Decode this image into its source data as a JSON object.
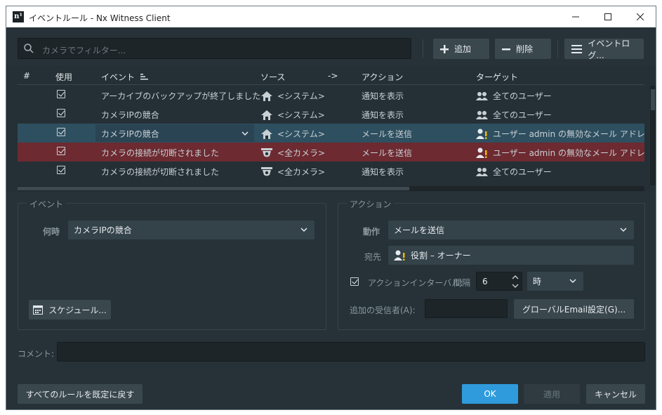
{
  "window": {
    "app_icon": "n¹",
    "title": "イベントルール - Nx Witness Client"
  },
  "toolbar": {
    "search_placeholder": "カメラでフィルター...",
    "add_label": "追加",
    "delete_label": "削除",
    "eventlog_label": "イベントログ..."
  },
  "table": {
    "headers": {
      "num": "#",
      "enabled": "使用",
      "event": "イベント",
      "source": "ソース",
      "arrow": "->",
      "action": "アクション",
      "target": "ターゲット"
    },
    "rows": [
      {
        "event": "アーカイブのバックアップが終了しました",
        "source": "<システム>",
        "source_icon": "home-icon",
        "action": "通知を表示",
        "target": "全てのユーザー",
        "target_icon": "users-icon",
        "state": "normal"
      },
      {
        "event": "カメラIPの競合",
        "source": "<システム>",
        "source_icon": "home-icon",
        "action": "通知を表示",
        "target": "全てのユーザー",
        "target_icon": "users-icon",
        "state": "normal"
      },
      {
        "event": "カメラIPの競合",
        "source": "<システム>",
        "source_icon": "home-icon",
        "action": "メールを送信",
        "target": "ユーザー admin の無効なメール アドレス",
        "target_icon": "user-warning-icon",
        "state": "selected"
      },
      {
        "event": "カメラの接続が切断されました",
        "source": "<全カメラ>",
        "source_icon": "camera-icon",
        "action": "メールを送信",
        "target": "ユーザー admin の無効なメール アドレス",
        "target_icon": "user-warning-icon",
        "state": "error"
      },
      {
        "event": "カメラの接続が切断されました",
        "source": "<全カメラ>",
        "source_icon": "camera-icon",
        "action": "通知を表示",
        "target": "全てのユーザー",
        "target_icon": "users-icon",
        "state": "normal"
      }
    ]
  },
  "event_panel": {
    "title": "イベント",
    "when_label": "何時",
    "when_value": "カメラIPの競合",
    "schedule_label": "スケジュール..."
  },
  "action_panel": {
    "title": "アクション",
    "action_label": "動作",
    "action_value": "メールを送信",
    "to_label": "宛先",
    "to_value": "役割 – オーナー",
    "interval_label": "アクションインターバル:",
    "interval_sub": "間隔",
    "interval_value": "6",
    "interval_unit": "時",
    "recipients_label": "追加の受信者(A):",
    "recipients_value": "",
    "global_email_label": "グローバルEmail設定(G)..."
  },
  "comment": {
    "label": "コメント:",
    "value": ""
  },
  "footer": {
    "reset_label": "すべてのルールを既定に戻す",
    "ok_label": "OK",
    "apply_label": "適用",
    "cancel_label": "キャンセル"
  },
  "colors": {
    "selected_row": "#2e4f60",
    "error_row": "#6d2a31",
    "primary": "#2f9bdc",
    "warning": "#f2b705"
  }
}
